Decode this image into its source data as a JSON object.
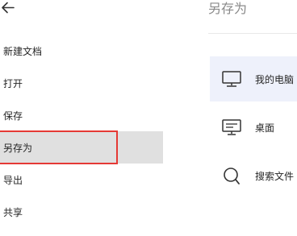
{
  "pane": {
    "title": "另存为"
  },
  "nav": {
    "items": [
      {
        "label": "新建文档"
      },
      {
        "label": "打开"
      },
      {
        "label": "保存"
      },
      {
        "label": "另存为"
      },
      {
        "label": "导出"
      },
      {
        "label": "共享"
      }
    ],
    "selected": "另存为"
  },
  "locations": [
    {
      "label": "我的电脑",
      "icon": "monitor-icon"
    },
    {
      "label": "桌面",
      "icon": "desktop-icon"
    },
    {
      "label": "搜索文件",
      "icon": "search-icon"
    }
  ],
  "colors": {
    "selected_nav_bg": "#e0e0e0",
    "selected_location_bg": "#eef1fb",
    "highlight_border": "#e53935"
  }
}
